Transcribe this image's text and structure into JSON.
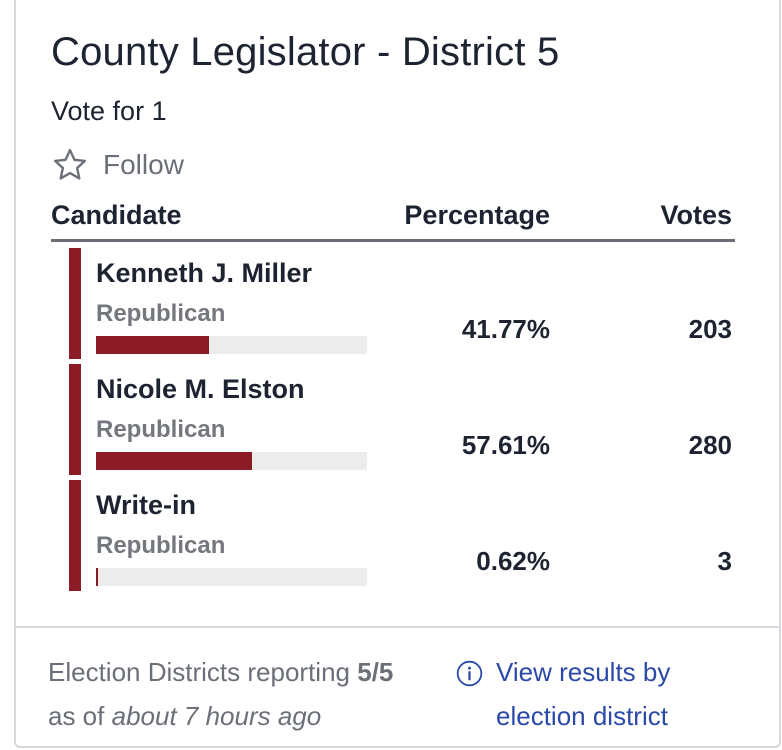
{
  "race": {
    "title": "County Legislator - District 5",
    "vote_for": "Vote for 1",
    "follow_label": "Follow"
  },
  "table": {
    "headers": {
      "candidate": "Candidate",
      "percentage": "Percentage",
      "votes": "Votes"
    },
    "rows": [
      {
        "name": "Kenneth J. Miller",
        "party": "Republican",
        "percentage": "41.77%",
        "votes": "203",
        "share": 0.4177
      },
      {
        "name": "Nicole M. Elston",
        "party": "Republican",
        "percentage": "57.61%",
        "votes": "280",
        "share": 0.5761
      },
      {
        "name": "Write-in",
        "party": "Republican",
        "percentage": "0.62%",
        "votes": "3",
        "share": 0.0062
      }
    ]
  },
  "footer": {
    "reporting_label": "Election Districts reporting",
    "reporting_value": "5/5",
    "as_of_prefix": "as of",
    "as_of_time": "about 7 hours ago",
    "link_line1": "View results by",
    "link_line2": "election district"
  },
  "colors": {
    "party_bar": "#8b1c25",
    "link": "#2b4aa8",
    "meter_bg": "#ececec"
  },
  "icons": {
    "follow": "star-outline-icon",
    "info": "info-circle-icon"
  }
}
